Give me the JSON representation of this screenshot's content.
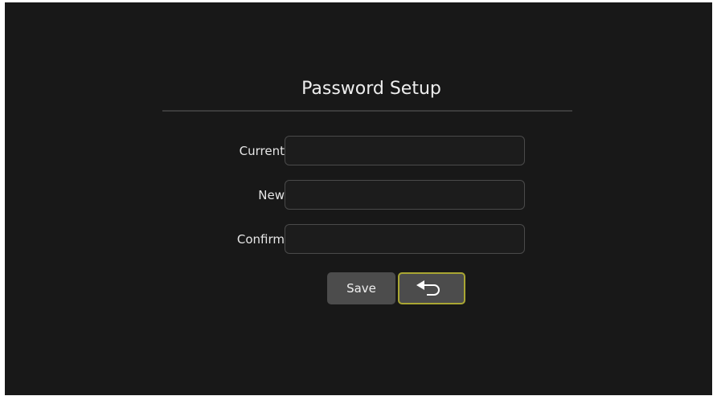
{
  "header": {
    "title": "Password Setup"
  },
  "form": {
    "fields": [
      {
        "label": "Current",
        "value": "",
        "placeholder": ""
      },
      {
        "label": "New",
        "value": "",
        "placeholder": ""
      },
      {
        "label": "Confirm",
        "value": "",
        "placeholder": ""
      }
    ]
  },
  "actions": {
    "save_label": "Save",
    "back_icon": "back-arrow-icon"
  },
  "colors": {
    "background": "#181818",
    "text": "#eeeeee",
    "button": "#4c4c4c",
    "focus_outline": "#a9a633"
  }
}
